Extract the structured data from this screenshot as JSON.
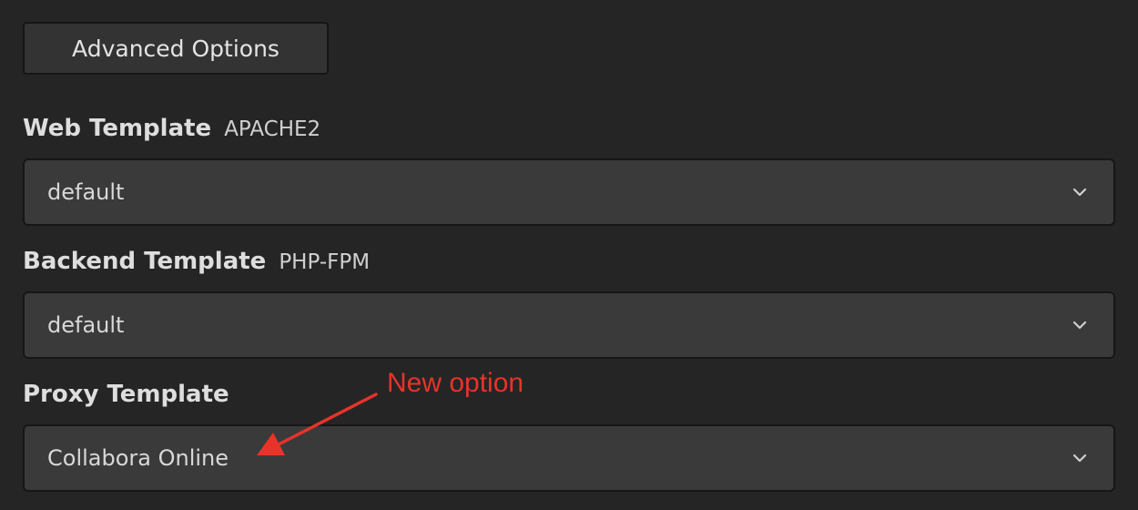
{
  "advanced_button": {
    "label": "Advanced Options"
  },
  "web_template": {
    "label": "Web Template",
    "sublabel": "APACHE2",
    "value": "default"
  },
  "backend_template": {
    "label": "Backend Template",
    "sublabel": "PHP-FPM",
    "value": "default"
  },
  "proxy_template": {
    "label": "Proxy Template",
    "value": "Collabora Online"
  },
  "annotation": {
    "text": "New option",
    "color": "#e8332a"
  },
  "colors": {
    "background": "#252525",
    "select_background": "#3a3a3a",
    "button_background": "#333333",
    "annotation": "#e8332a"
  },
  "icons": {
    "select_indicator": "chevron-down-icon",
    "annotation_pointer": "arrow-icon"
  }
}
